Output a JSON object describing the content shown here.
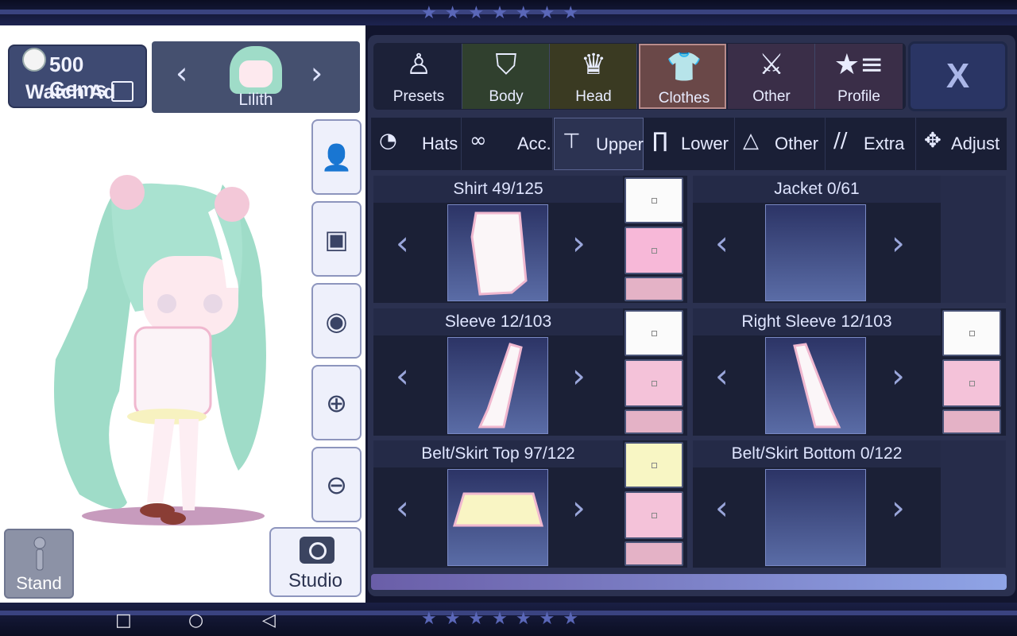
{
  "currency": {
    "gems_text": "500 Gems",
    "watch_ad": "Watch Ad"
  },
  "character": {
    "name": "Lilith"
  },
  "categories": [
    {
      "label": "Presets",
      "icon": "person-icon"
    },
    {
      "label": "Body",
      "icon": "jacket-icon"
    },
    {
      "label": "Head",
      "icon": "hair-icon"
    },
    {
      "label": "Clothes",
      "icon": "shirt-icon",
      "selected": true
    },
    {
      "label": "Other",
      "icon": "sword-cat-icon"
    },
    {
      "label": "Profile",
      "icon": "star-list-icon"
    }
  ],
  "close_label": "X",
  "subtabs": [
    {
      "label": "Hats"
    },
    {
      "label": "Acc."
    },
    {
      "label": "Upper",
      "selected": true
    },
    {
      "label": "Lower"
    },
    {
      "label": "Other"
    },
    {
      "label": "Extra"
    },
    {
      "label": "Adjust"
    }
  ],
  "slots": [
    {
      "title": "Shirt 49/125",
      "colors": [
        "#fbfbfb",
        "#f7b8d8",
        "#e4b2c6"
      ]
    },
    {
      "title": "Jacket 0/61",
      "colors": []
    },
    {
      "title": "Sleeve 12/103",
      "colors": [
        "#fbfbfb",
        "#f4c2d9",
        "#e4b2c6"
      ]
    },
    {
      "title": "Right Sleeve 12/103",
      "colors": [
        "#fbfbfb",
        "#f4c2d9",
        "#e4b2c6"
      ]
    },
    {
      "title": "Belt/Skirt Top 97/122",
      "colors": [
        "#f8f6c4",
        "#f4c2d9",
        "#e4b2c6"
      ]
    },
    {
      "title": "Belt/Skirt Bottom 0/122",
      "colors": []
    }
  ],
  "bottom": {
    "stand_label": "Stand",
    "studio_label": "Studio"
  },
  "side_tools": [
    "add-person-icon",
    "background-image-icon",
    "eye-icon",
    "zoom-in-icon",
    "zoom-out-icon"
  ],
  "theme": {
    "accent": "#3a4380",
    "selected_tab": "#c98a8a"
  }
}
